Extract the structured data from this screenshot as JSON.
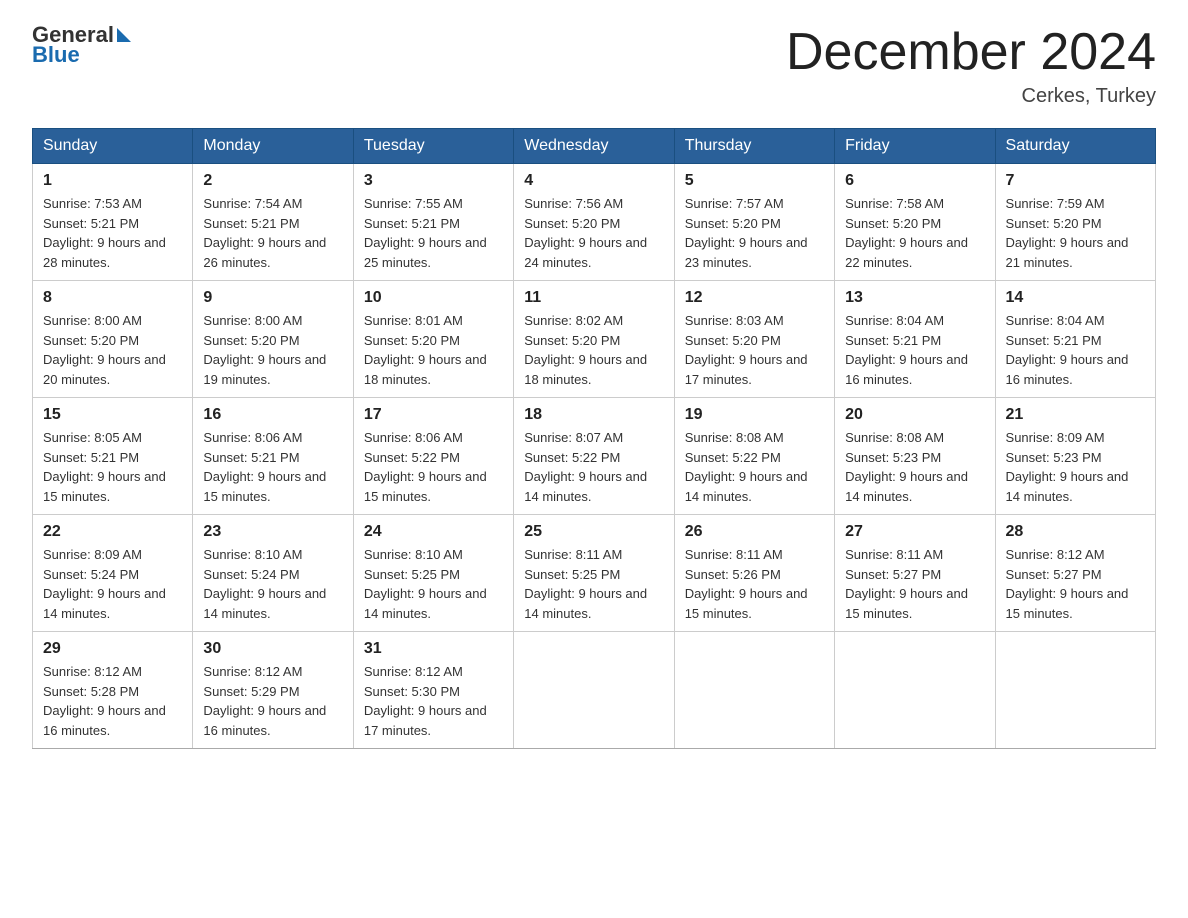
{
  "header": {
    "logo_general": "General",
    "logo_blue": "Blue",
    "title": "December 2024",
    "location": "Cerkes, Turkey"
  },
  "days_of_week": [
    "Sunday",
    "Monday",
    "Tuesday",
    "Wednesday",
    "Thursday",
    "Friday",
    "Saturday"
  ],
  "weeks": [
    [
      {
        "day": "1",
        "sunrise": "Sunrise: 7:53 AM",
        "sunset": "Sunset: 5:21 PM",
        "daylight": "Daylight: 9 hours and 28 minutes."
      },
      {
        "day": "2",
        "sunrise": "Sunrise: 7:54 AM",
        "sunset": "Sunset: 5:21 PM",
        "daylight": "Daylight: 9 hours and 26 minutes."
      },
      {
        "day": "3",
        "sunrise": "Sunrise: 7:55 AM",
        "sunset": "Sunset: 5:21 PM",
        "daylight": "Daylight: 9 hours and 25 minutes."
      },
      {
        "day": "4",
        "sunrise": "Sunrise: 7:56 AM",
        "sunset": "Sunset: 5:20 PM",
        "daylight": "Daylight: 9 hours and 24 minutes."
      },
      {
        "day": "5",
        "sunrise": "Sunrise: 7:57 AM",
        "sunset": "Sunset: 5:20 PM",
        "daylight": "Daylight: 9 hours and 23 minutes."
      },
      {
        "day": "6",
        "sunrise": "Sunrise: 7:58 AM",
        "sunset": "Sunset: 5:20 PM",
        "daylight": "Daylight: 9 hours and 22 minutes."
      },
      {
        "day": "7",
        "sunrise": "Sunrise: 7:59 AM",
        "sunset": "Sunset: 5:20 PM",
        "daylight": "Daylight: 9 hours and 21 minutes."
      }
    ],
    [
      {
        "day": "8",
        "sunrise": "Sunrise: 8:00 AM",
        "sunset": "Sunset: 5:20 PM",
        "daylight": "Daylight: 9 hours and 20 minutes."
      },
      {
        "day": "9",
        "sunrise": "Sunrise: 8:00 AM",
        "sunset": "Sunset: 5:20 PM",
        "daylight": "Daylight: 9 hours and 19 minutes."
      },
      {
        "day": "10",
        "sunrise": "Sunrise: 8:01 AM",
        "sunset": "Sunset: 5:20 PM",
        "daylight": "Daylight: 9 hours and 18 minutes."
      },
      {
        "day": "11",
        "sunrise": "Sunrise: 8:02 AM",
        "sunset": "Sunset: 5:20 PM",
        "daylight": "Daylight: 9 hours and 18 minutes."
      },
      {
        "day": "12",
        "sunrise": "Sunrise: 8:03 AM",
        "sunset": "Sunset: 5:20 PM",
        "daylight": "Daylight: 9 hours and 17 minutes."
      },
      {
        "day": "13",
        "sunrise": "Sunrise: 8:04 AM",
        "sunset": "Sunset: 5:21 PM",
        "daylight": "Daylight: 9 hours and 16 minutes."
      },
      {
        "day": "14",
        "sunrise": "Sunrise: 8:04 AM",
        "sunset": "Sunset: 5:21 PM",
        "daylight": "Daylight: 9 hours and 16 minutes."
      }
    ],
    [
      {
        "day": "15",
        "sunrise": "Sunrise: 8:05 AM",
        "sunset": "Sunset: 5:21 PM",
        "daylight": "Daylight: 9 hours and 15 minutes."
      },
      {
        "day": "16",
        "sunrise": "Sunrise: 8:06 AM",
        "sunset": "Sunset: 5:21 PM",
        "daylight": "Daylight: 9 hours and 15 minutes."
      },
      {
        "day": "17",
        "sunrise": "Sunrise: 8:06 AM",
        "sunset": "Sunset: 5:22 PM",
        "daylight": "Daylight: 9 hours and 15 minutes."
      },
      {
        "day": "18",
        "sunrise": "Sunrise: 8:07 AM",
        "sunset": "Sunset: 5:22 PM",
        "daylight": "Daylight: 9 hours and 14 minutes."
      },
      {
        "day": "19",
        "sunrise": "Sunrise: 8:08 AM",
        "sunset": "Sunset: 5:22 PM",
        "daylight": "Daylight: 9 hours and 14 minutes."
      },
      {
        "day": "20",
        "sunrise": "Sunrise: 8:08 AM",
        "sunset": "Sunset: 5:23 PM",
        "daylight": "Daylight: 9 hours and 14 minutes."
      },
      {
        "day": "21",
        "sunrise": "Sunrise: 8:09 AM",
        "sunset": "Sunset: 5:23 PM",
        "daylight": "Daylight: 9 hours and 14 minutes."
      }
    ],
    [
      {
        "day": "22",
        "sunrise": "Sunrise: 8:09 AM",
        "sunset": "Sunset: 5:24 PM",
        "daylight": "Daylight: 9 hours and 14 minutes."
      },
      {
        "day": "23",
        "sunrise": "Sunrise: 8:10 AM",
        "sunset": "Sunset: 5:24 PM",
        "daylight": "Daylight: 9 hours and 14 minutes."
      },
      {
        "day": "24",
        "sunrise": "Sunrise: 8:10 AM",
        "sunset": "Sunset: 5:25 PM",
        "daylight": "Daylight: 9 hours and 14 minutes."
      },
      {
        "day": "25",
        "sunrise": "Sunrise: 8:11 AM",
        "sunset": "Sunset: 5:25 PM",
        "daylight": "Daylight: 9 hours and 14 minutes."
      },
      {
        "day": "26",
        "sunrise": "Sunrise: 8:11 AM",
        "sunset": "Sunset: 5:26 PM",
        "daylight": "Daylight: 9 hours and 15 minutes."
      },
      {
        "day": "27",
        "sunrise": "Sunrise: 8:11 AM",
        "sunset": "Sunset: 5:27 PM",
        "daylight": "Daylight: 9 hours and 15 minutes."
      },
      {
        "day": "28",
        "sunrise": "Sunrise: 8:12 AM",
        "sunset": "Sunset: 5:27 PM",
        "daylight": "Daylight: 9 hours and 15 minutes."
      }
    ],
    [
      {
        "day": "29",
        "sunrise": "Sunrise: 8:12 AM",
        "sunset": "Sunset: 5:28 PM",
        "daylight": "Daylight: 9 hours and 16 minutes."
      },
      {
        "day": "30",
        "sunrise": "Sunrise: 8:12 AM",
        "sunset": "Sunset: 5:29 PM",
        "daylight": "Daylight: 9 hours and 16 minutes."
      },
      {
        "day": "31",
        "sunrise": "Sunrise: 8:12 AM",
        "sunset": "Sunset: 5:30 PM",
        "daylight": "Daylight: 9 hours and 17 minutes."
      },
      null,
      null,
      null,
      null
    ]
  ]
}
